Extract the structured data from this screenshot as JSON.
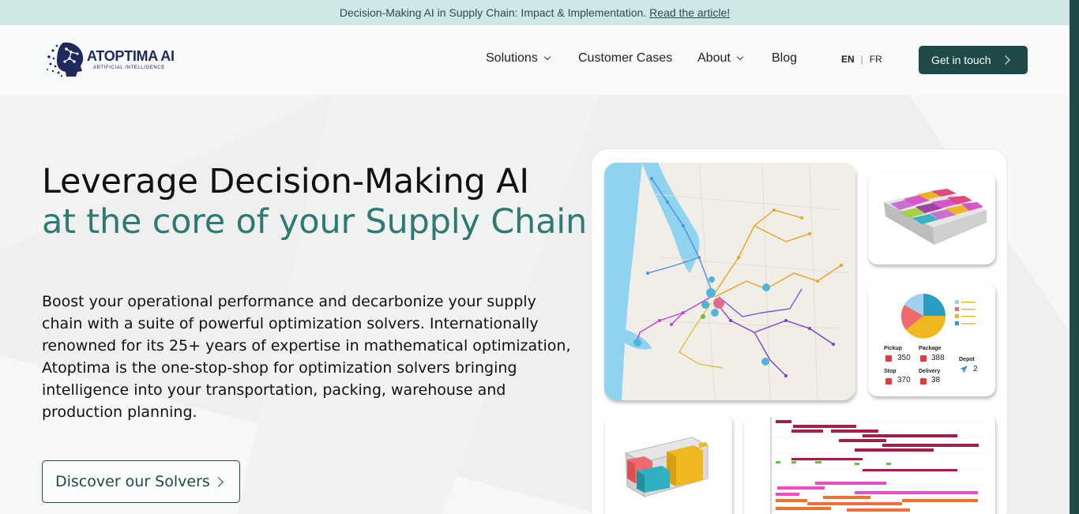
{
  "announcement": {
    "text": "Decision-Making AI in Supply Chain: Impact & Implementation.",
    "link": "Read the article!"
  },
  "brand": {
    "name": "ATOPTIMA AI",
    "tagline": "ARTIFICIAL INTELLIGENCE"
  },
  "nav": {
    "items": [
      {
        "label": "Solutions",
        "dropdown": true
      },
      {
        "label": "Customer Cases",
        "dropdown": false
      },
      {
        "label": "About",
        "dropdown": true
      },
      {
        "label": "Blog",
        "dropdown": false
      }
    ],
    "lang_active": "EN",
    "lang_other": "FR",
    "cta": "Get in touch"
  },
  "hero": {
    "title_line1": "Leverage Decision-Making AI",
    "title_line2": "at the core of your Supply Chain",
    "paragraph": "Boost your operational performance and decarbonize your supply chain with a suite of powerful optimization solvers. Internationally renowned for its 25+ years of expertise in mathematical optimization, Atoptima is the one-stop-shop for optimization solvers bringing intelligence into your transportation, packing, warehouse and production planning.",
    "button": "Discover our Solvers"
  },
  "stats": {
    "pickup_label": "Pickup",
    "pickup_value": "350",
    "package_label": "Package",
    "package_value": "388",
    "stop_label": "Stop",
    "stop_value": "370",
    "delivery_label": "Delivery",
    "delivery_value": "38",
    "depot_label": "Depot",
    "depot_value": "2"
  },
  "colors": {
    "accent_dark": "#1e4a4a",
    "accent_teal": "#2e7a73",
    "announcement_bg": "#cfe8e6"
  }
}
